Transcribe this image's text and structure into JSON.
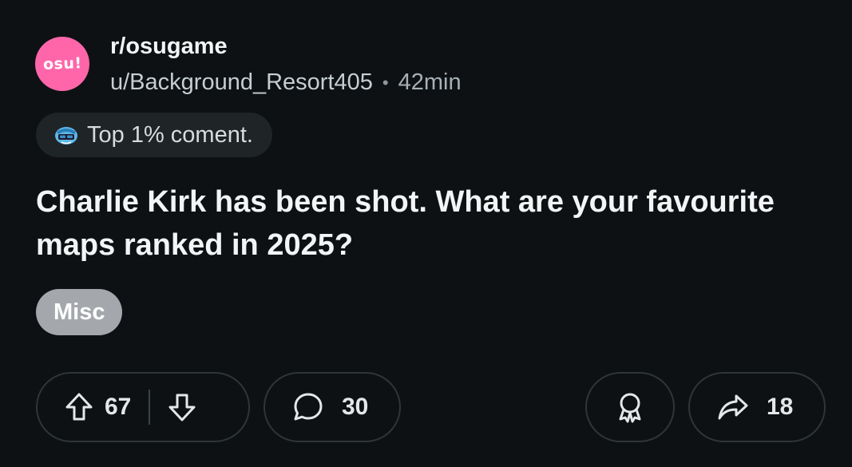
{
  "post": {
    "avatar_text": "osu!",
    "subreddit": "r/osugame",
    "author": "u/Background_Resort405",
    "separator": "•",
    "age": "42min",
    "badge": {
      "icon": "top-commenter-icon",
      "label": "Top 1% coment."
    },
    "title": "Charlie Kirk has been shot. What are your favourite maps ranked in 2025?",
    "flair": "Misc"
  },
  "actions": {
    "upvote_icon": "upvote-arrow-icon",
    "vote_count": "67",
    "downvote_icon": "downvote-arrow-icon",
    "comment_icon": "comment-bubble-icon",
    "comment_count": "30",
    "award_icon": "award-icon",
    "share_icon": "share-arrow-icon",
    "share_count": "18"
  },
  "colors": {
    "background": "#0e1113",
    "avatar": "#ff66aa",
    "badge_bg": "#1f2427",
    "flair_bg": "#a4a8ac",
    "pill_border": "#2f3538"
  }
}
